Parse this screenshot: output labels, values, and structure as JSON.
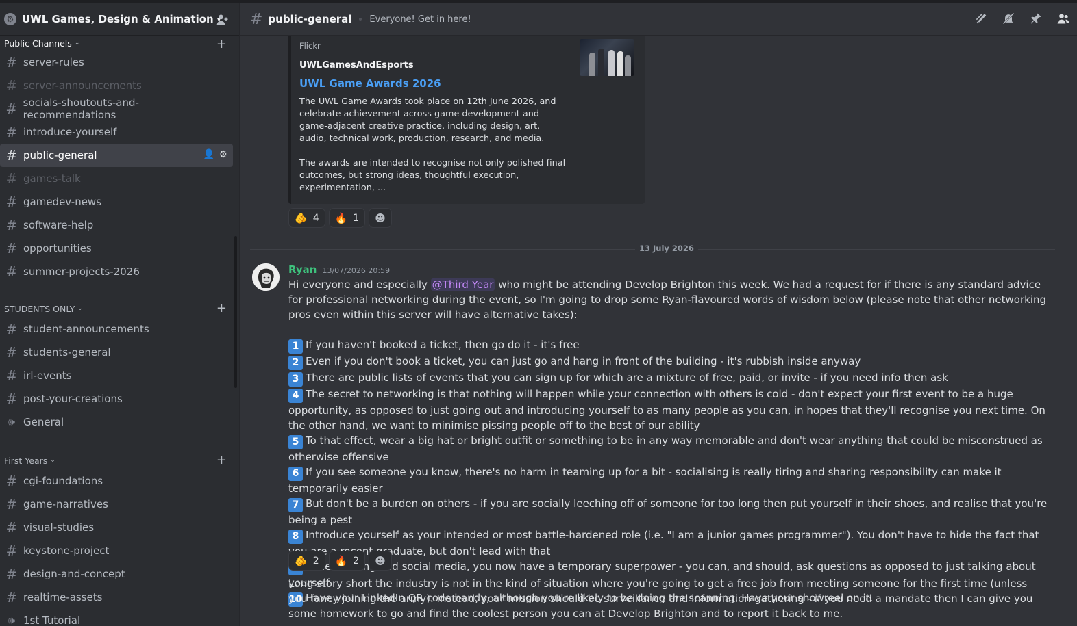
{
  "server": {
    "name": "UWL Games, Design & Animation"
  },
  "categories": {
    "public": "Public Channels",
    "students": "STUDENTS ONLY",
    "first_years": "First Years"
  },
  "channels_public": [
    "server-rules",
    "server-announcements",
    "socials-shoutouts-and-recommendations",
    "introduce-yourself",
    "public-general",
    "games-talk",
    "gamedev-news",
    "software-help",
    "opportunities",
    "summer-projects-2026"
  ],
  "channels_students": [
    "student-announcements",
    "students-general",
    "irl-events",
    "post-your-creations",
    "General"
  ],
  "channels_first": [
    "cgi-foundations",
    "game-narratives",
    "visual-studies",
    "keystone-project",
    "design-and-concept",
    "realtime-assets",
    "1st Tutorial"
  ],
  "header": {
    "channel": "public-general",
    "topic": "Everyone! Get in here!"
  },
  "embed": {
    "provider": "Flickr",
    "author": "UWLGamesAndEsports",
    "title": "UWL Game Awards 2026",
    "desc1": "The UWL Game Awards took place on 12th June 2026, and celebrate achievement across game development and game-adjacent creative practice, including design, art, audio, technical work, production, research, and media.",
    "desc2": "The awards are intended to recognise not only polished final outcomes, but strong ideas, thoughtful execution, experimentation, ..."
  },
  "reactions1": [
    {
      "emoji": "🫵",
      "count": "4"
    },
    {
      "emoji": "🔥",
      "count": "1"
    }
  ],
  "reactions2": [
    {
      "emoji": "🫵",
      "count": "2"
    },
    {
      "emoji": "🔥",
      "count": "2"
    }
  ],
  "divider_date": "13 July 2026",
  "message": {
    "author": "Ryan",
    "time": "13/07/2026 20:59",
    "intro_a": "Hi everyone and especially ",
    "mention": "@Third Year",
    "intro_b": " who might be attending Develop Brighton this week. We had a request for if there is any standard advice for professional networking during the event, so I'm going to drop some Ryan-flavoured words of wisdom below (please note that other networking pros even within this server will have alternative takes):",
    "items": [
      {
        "n": "1",
        "t": "If you haven't booked a ticket, then go do it - it's free"
      },
      {
        "n": "2",
        "t": "Even if you don't book a ticket, you can just go and hang in front of the building - it's rubbish inside anyway"
      },
      {
        "n": "3",
        "t": "There are public lists of events that you can sign up for which are a mixture of free, paid, or invite - if you need info then ask"
      },
      {
        "n": "4",
        "t": "The secret to networking is that nothing will happen while your connection with others is cold - don't expect your first event to be a huge opportunity, as opposed to just going out and introducing yourself to as many people as you can, in hopes that they'll recognise you next time. On the other hand, we want to minimise pissing people off to the best of our ability"
      },
      {
        "n": "5",
        "t": "To that effect, wear a big hat or bright outfit or something to be in any way memorable and don't wear anything that could be misconstrued as otherwise offensive"
      },
      {
        "n": "6",
        "t": "If you see someone you know, there's no harm in teaming up for a bit - socialising is really tiring and sharing responsibility can make it temporarily easier"
      },
      {
        "n": "7",
        "t": "But don't be a burden on others - if you are socially leeching off of someone for too long then put yourself in their shoes, and realise that you're being a pest"
      },
      {
        "n": "8",
        "t": "Introduce yourself as your intended or most battle-hardened role (i.e. \"I am a junior games programmer\"). You don't have to hide the fact that you are a recent graduate, but don't lead with that"
      },
      {
        "n": "9",
        "t": "In networking and social media, you now have a temporary superpower - you can, and should, ask questions as opposed to just talking about yourself"
      },
      {
        "n": "10",
        "t": "Have your LinkedIn QR code handy, although you're likely to be doing the scanning. Have your showreel on it."
      }
    ],
    "followup": "Long story short the industry is not in the kind of situation where you're going to get a free job from meeting someone for the first time (unless you fancy joining the army). Instead, your mission should be surveillance and information-gathering - if you need a mandate then I can give you some homework to go and find the coolest person you can at Develop Brighton and to report it back to me."
  }
}
